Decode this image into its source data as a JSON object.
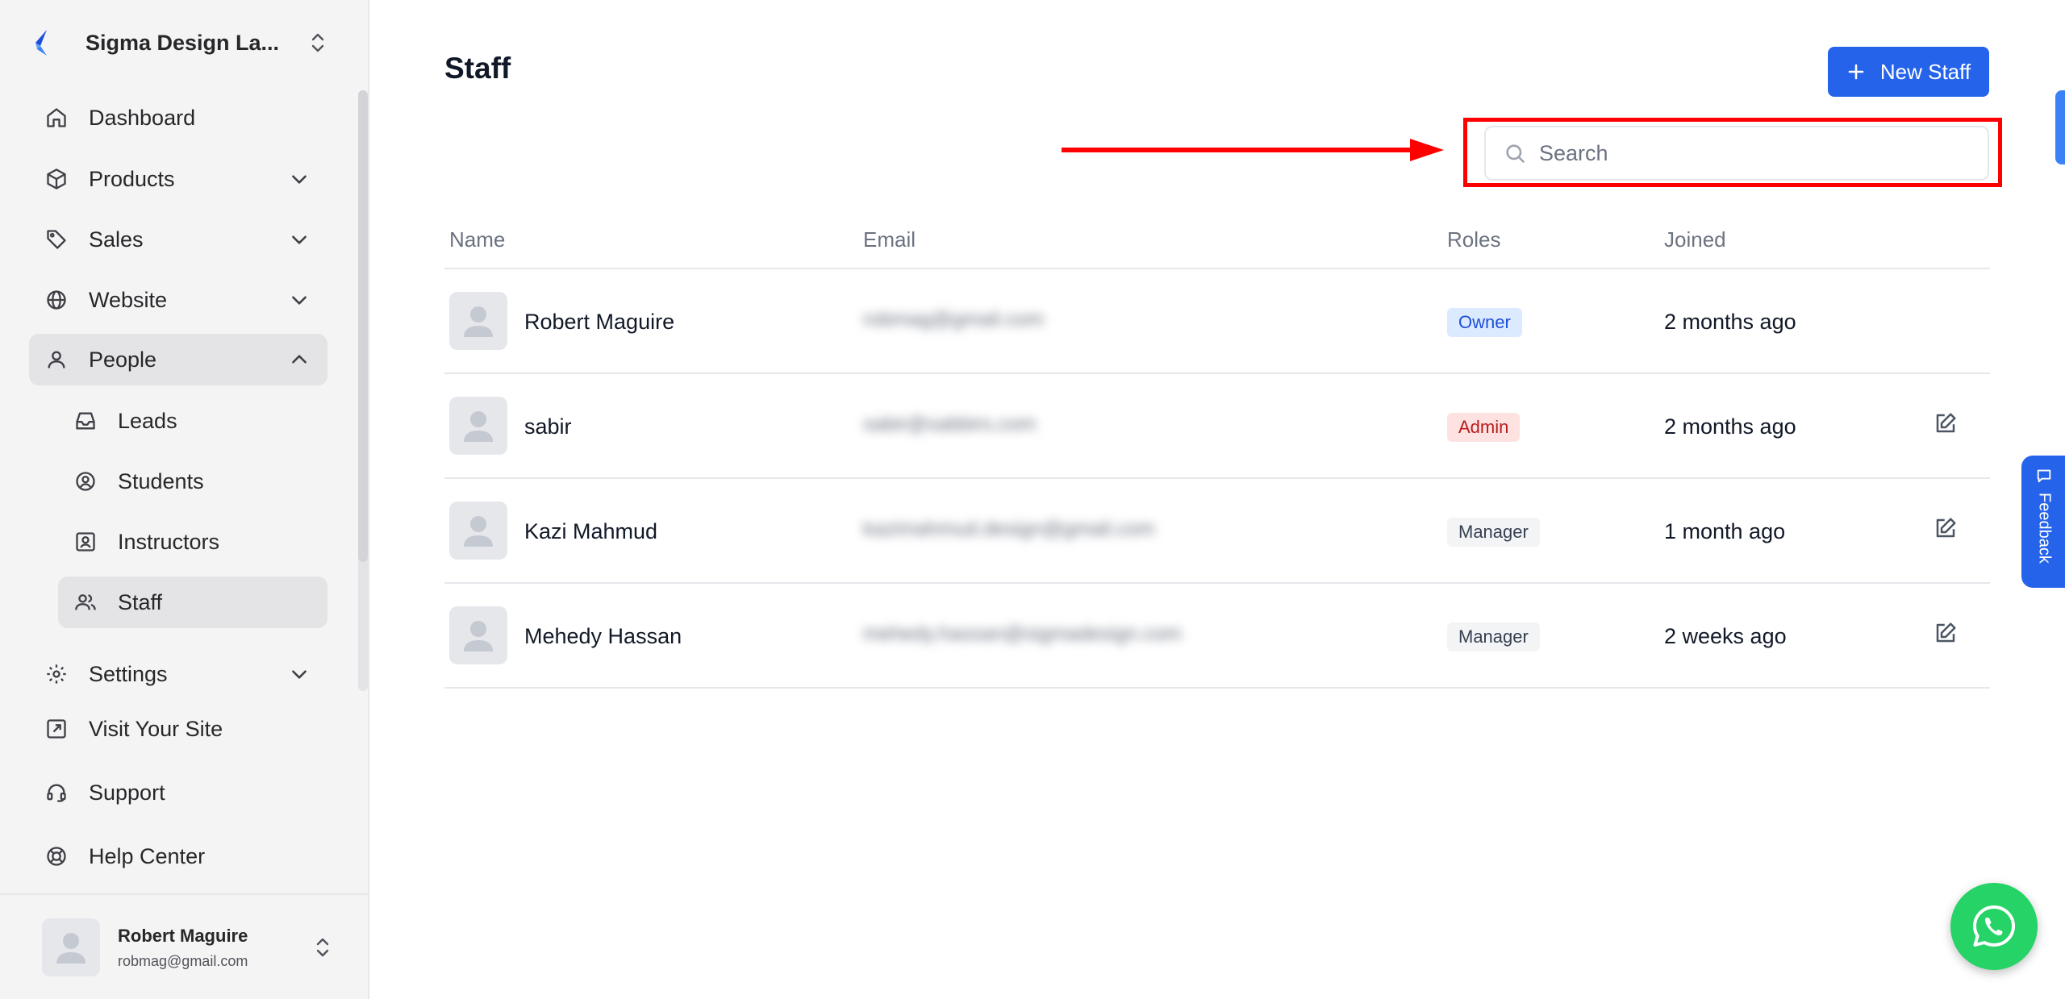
{
  "sidebar": {
    "brand": "Sigma Design La...",
    "nav": [
      {
        "label": "Dashboard"
      },
      {
        "label": "Products"
      },
      {
        "label": "Sales"
      },
      {
        "label": "Website"
      },
      {
        "label": "People"
      }
    ],
    "people_sub": [
      {
        "label": "Leads"
      },
      {
        "label": "Students"
      },
      {
        "label": "Instructors"
      },
      {
        "label": "Staff"
      }
    ],
    "bottom": [
      {
        "label": "Settings"
      },
      {
        "label": "Visit Your Site"
      },
      {
        "label": "Support"
      },
      {
        "label": "Help Center"
      }
    ],
    "user": {
      "name": "Robert Maguire",
      "email": "robmag@gmail.com"
    }
  },
  "page": {
    "title": "Staff",
    "new_button": "New Staff",
    "search_placeholder": "Search"
  },
  "table": {
    "headers": [
      "Name",
      "Email",
      "Roles",
      "Joined"
    ],
    "rows": [
      {
        "name": "Robert Maguire",
        "email": "robmag@gmail.com",
        "role": "Owner",
        "joined": "2 months ago"
      },
      {
        "name": "sabir",
        "email": "sabir@sabbirs.com",
        "role": "Admin",
        "joined": "2 months ago"
      },
      {
        "name": "Kazi Mahmud",
        "email": "kazimahmud.design@gmail.com",
        "role": "Manager",
        "joined": "1 month ago"
      },
      {
        "name": "Mehedy Hassan",
        "email": "mehedy.hassan@sigmadesign.com",
        "role": "Manager",
        "joined": "2 weeks ago"
      }
    ]
  },
  "feedback": "Feedback",
  "colors": {
    "accent": "#2563eb",
    "highlight": "#ff0000",
    "whatsapp": "#25d366"
  }
}
